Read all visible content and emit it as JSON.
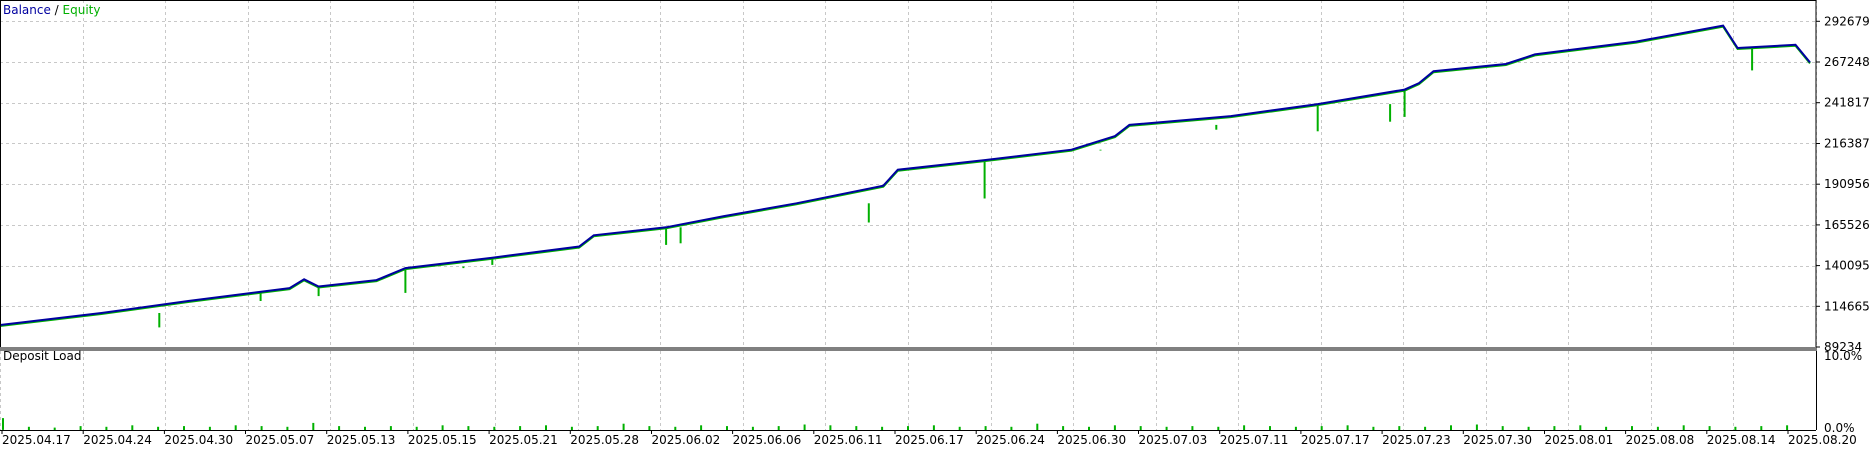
{
  "legend": {
    "balance_label": "Balance",
    "separator": " / ",
    "equity_label": "Equity",
    "balance_color": "#0000a0",
    "equity_color": "#00b000"
  },
  "load_panel": {
    "title": "Deposit Load",
    "top_label": "10.0%",
    "bottom_label": "0.0%"
  },
  "chart_data": [
    {
      "type": "line",
      "series": [
        {
          "name": "Balance",
          "color": "#0000a0",
          "points": [
            {
              "x": "2025.04.17",
              "y": 103000
            },
            {
              "x": "2025.04.24",
              "y": 110500
            },
            {
              "x": "2025.04.30",
              "y": 118000
            },
            {
              "x": "2025.05.07",
              "y": 126000
            },
            {
              "x": "2025.05.08",
              "y": 131500
            },
            {
              "x": "2025.05.09",
              "y": 127000
            },
            {
              "x": "2025.05.13",
              "y": 131000
            },
            {
              "x": "2025.05.15",
              "y": 138500
            },
            {
              "x": "2025.05.21",
              "y": 145000
            },
            {
              "x": "2025.05.27",
              "y": 152000
            },
            {
              "x": "2025.05.28",
              "y": 159000
            },
            {
              "x": "2025.06.02",
              "y": 164000
            },
            {
              "x": "2025.06.06",
              "y": 171000
            },
            {
              "x": "2025.06.11",
              "y": 179000
            },
            {
              "x": "2025.06.17",
              "y": 190000
            },
            {
              "x": "2025.06.18",
              "y": 200000
            },
            {
              "x": "2025.06.24",
              "y": 206000
            },
            {
              "x": "2025.06.30",
              "y": 212500
            },
            {
              "x": "2025.07.03",
              "y": 221000
            },
            {
              "x": "2025.07.04",
              "y": 228000
            },
            {
              "x": "2025.07.11",
              "y": 233500
            },
            {
              "x": "2025.07.17",
              "y": 241000
            },
            {
              "x": "2025.07.23",
              "y": 250000
            },
            {
              "x": "2025.07.24",
              "y": 254000
            },
            {
              "x": "2025.07.25",
              "y": 261500
            },
            {
              "x": "2025.07.30",
              "y": 266000
            },
            {
              "x": "2025.08.01",
              "y": 272000
            },
            {
              "x": "2025.08.08",
              "y": 280000
            },
            {
              "x": "2025.08.14",
              "y": 290000
            },
            {
              "x": "2025.08.15",
              "y": 276000
            },
            {
              "x": "2025.08.19",
              "y": 278000
            },
            {
              "x": "2025.08.20",
              "y": 267000
            }
          ]
        },
        {
          "name": "Equity",
          "color": "#00b000",
          "drawdowns": [
            {
              "x": "2025.04.28",
              "y": 101500
            },
            {
              "x": "2025.05.05",
              "y": 124000
            },
            {
              "x": "2025.05.09",
              "y": 121000
            },
            {
              "x": "2025.05.15",
              "y": 123000
            },
            {
              "x": "2025.05.19",
              "y": 139500
            },
            {
              "x": "2025.05.21",
              "y": 140500
            },
            {
              "x": "2025.06.02",
              "y": 153000
            },
            {
              "x": "2025.06.03",
              "y": 154000
            },
            {
              "x": "2025.06.16",
              "y": 167000
            },
            {
              "x": "2025.06.24",
              "y": 182000
            },
            {
              "x": "2025.07.02",
              "y": 212000
            },
            {
              "x": "2025.07.10",
              "y": 225000
            },
            {
              "x": "2025.07.17",
              "y": 224000
            },
            {
              "x": "2025.07.22",
              "y": 230000
            },
            {
              "x": "2025.07.23",
              "y": 233000
            },
            {
              "x": "2025.08.16",
              "y": 262000
            }
          ]
        }
      ],
      "x_tick_labels": [
        "2025.04.17",
        "2025.04.24",
        "2025.04.30",
        "2025.05.07",
        "2025.05.13",
        "2025.05.15",
        "2025.05.21",
        "2025.05.28",
        "2025.06.02",
        "2025.06.06",
        "2025.06.11",
        "2025.06.17",
        "2025.06.24",
        "2025.06.30",
        "2025.07.03",
        "2025.07.11",
        "2025.07.17",
        "2025.07.23",
        "2025.07.30",
        "2025.08.01",
        "2025.08.08",
        "2025.08.14",
        "2025.08.20"
      ],
      "y_tick_labels": [
        "292679",
        "267248",
        "241817",
        "216387",
        "190956",
        "165526",
        "140095",
        "114665",
        "89234"
      ],
      "ylim": [
        89234,
        306000
      ],
      "grid": true,
      "legend_position": "top-left"
    },
    {
      "type": "bar",
      "title": "Deposit Load",
      "ylim": [
        0,
        10
      ],
      "y_tick_labels": [
        "10.0%",
        "0.0%"
      ],
      "values": [
        1.5,
        0.4,
        0.3,
        0.5,
        0.4,
        0.6,
        0.4,
        0.5,
        0.4,
        0.6,
        0.5,
        0.4,
        0.9,
        0.5,
        0.4,
        0.5,
        0.4,
        0.6,
        0.5,
        0.4,
        0.5,
        0.6,
        0.4,
        0.5,
        0.8,
        0.5,
        0.4,
        0.6,
        0.5,
        0.4,
        0.5,
        0.7,
        0.6,
        0.5,
        0.4,
        0.5,
        0.6,
        0.4,
        0.5,
        0.4,
        0.8,
        0.5,
        0.4,
        0.6,
        0.5,
        0.4,
        0.5,
        0.4,
        0.6,
        0.5,
        0.4,
        0.5,
        0.6,
        0.4,
        0.5,
        0.4,
        0.6,
        0.7,
        0.5,
        0.4,
        0.5,
        0.6,
        0.4,
        0.5,
        0.4,
        0.6,
        0.5,
        0.4,
        0.5,
        0.6
      ]
    }
  ]
}
